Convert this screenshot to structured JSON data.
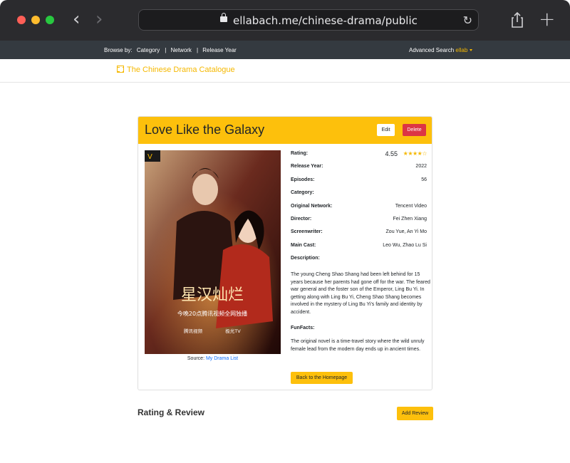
{
  "browser": {
    "url": "ellabach.me/chinese-drama/public"
  },
  "navbar": {
    "browse_by": "Browse by:",
    "links": [
      "Category",
      "Network",
      "Release Year"
    ],
    "advanced_search": "Advanced Search",
    "username": "ellab"
  },
  "brand": {
    "title": "The Chinese Drama Catalogue",
    "icon": "film-icon"
  },
  "drama": {
    "title": "Love Like the Galaxy",
    "edit_label": "Edit",
    "delete_label": "Delete",
    "rating_label": "Rating:",
    "rating_value": "4.55",
    "rating_stars": 4,
    "release_year_label": "Release Year:",
    "release_year": "2022",
    "episodes_label": "Episodes:",
    "episodes": "56",
    "category_label": "Category:",
    "category": "",
    "network_label": "Original Network:",
    "network": "Tencent Video",
    "director_label": "Director:",
    "director": "Fei Zhen Xiang",
    "screenwriter_label": "Screenwriter:",
    "screenwriter": "Zou Yue, An Yi Mo",
    "cast_label": "Main Cast:",
    "cast": "Leo Wu, Zhao Lu Si",
    "description_label": "Description:",
    "description": "The young Cheng Shao Shang had been left behind for 15 years because her parents had gone off for the war. The feared war general and the foster son of the Emperor, Ling Bu Yi. In getting along with Ling Bu Yi, Cheng Shao Shang becomes involved in the mystery of Ling Bu Yi's family and identity by accident.",
    "funfacts_label": "FunFacts:",
    "funfacts": "The original novel is a time-travel story where the wild unruly female lead from the modern day ends up in ancient times.",
    "source_prefix": "Source:",
    "source_link": "My Drama List",
    "home_button": "Back to the Homepage"
  },
  "poster": {
    "title_cn": "星汉灿烂",
    "subtitle_cn": "今晚20点腾讯视频全网独播",
    "platform_1": "腾讯视频",
    "platform_2": "极光TV"
  },
  "review": {
    "heading": "Rating & Review",
    "add_button": "Add Review"
  }
}
